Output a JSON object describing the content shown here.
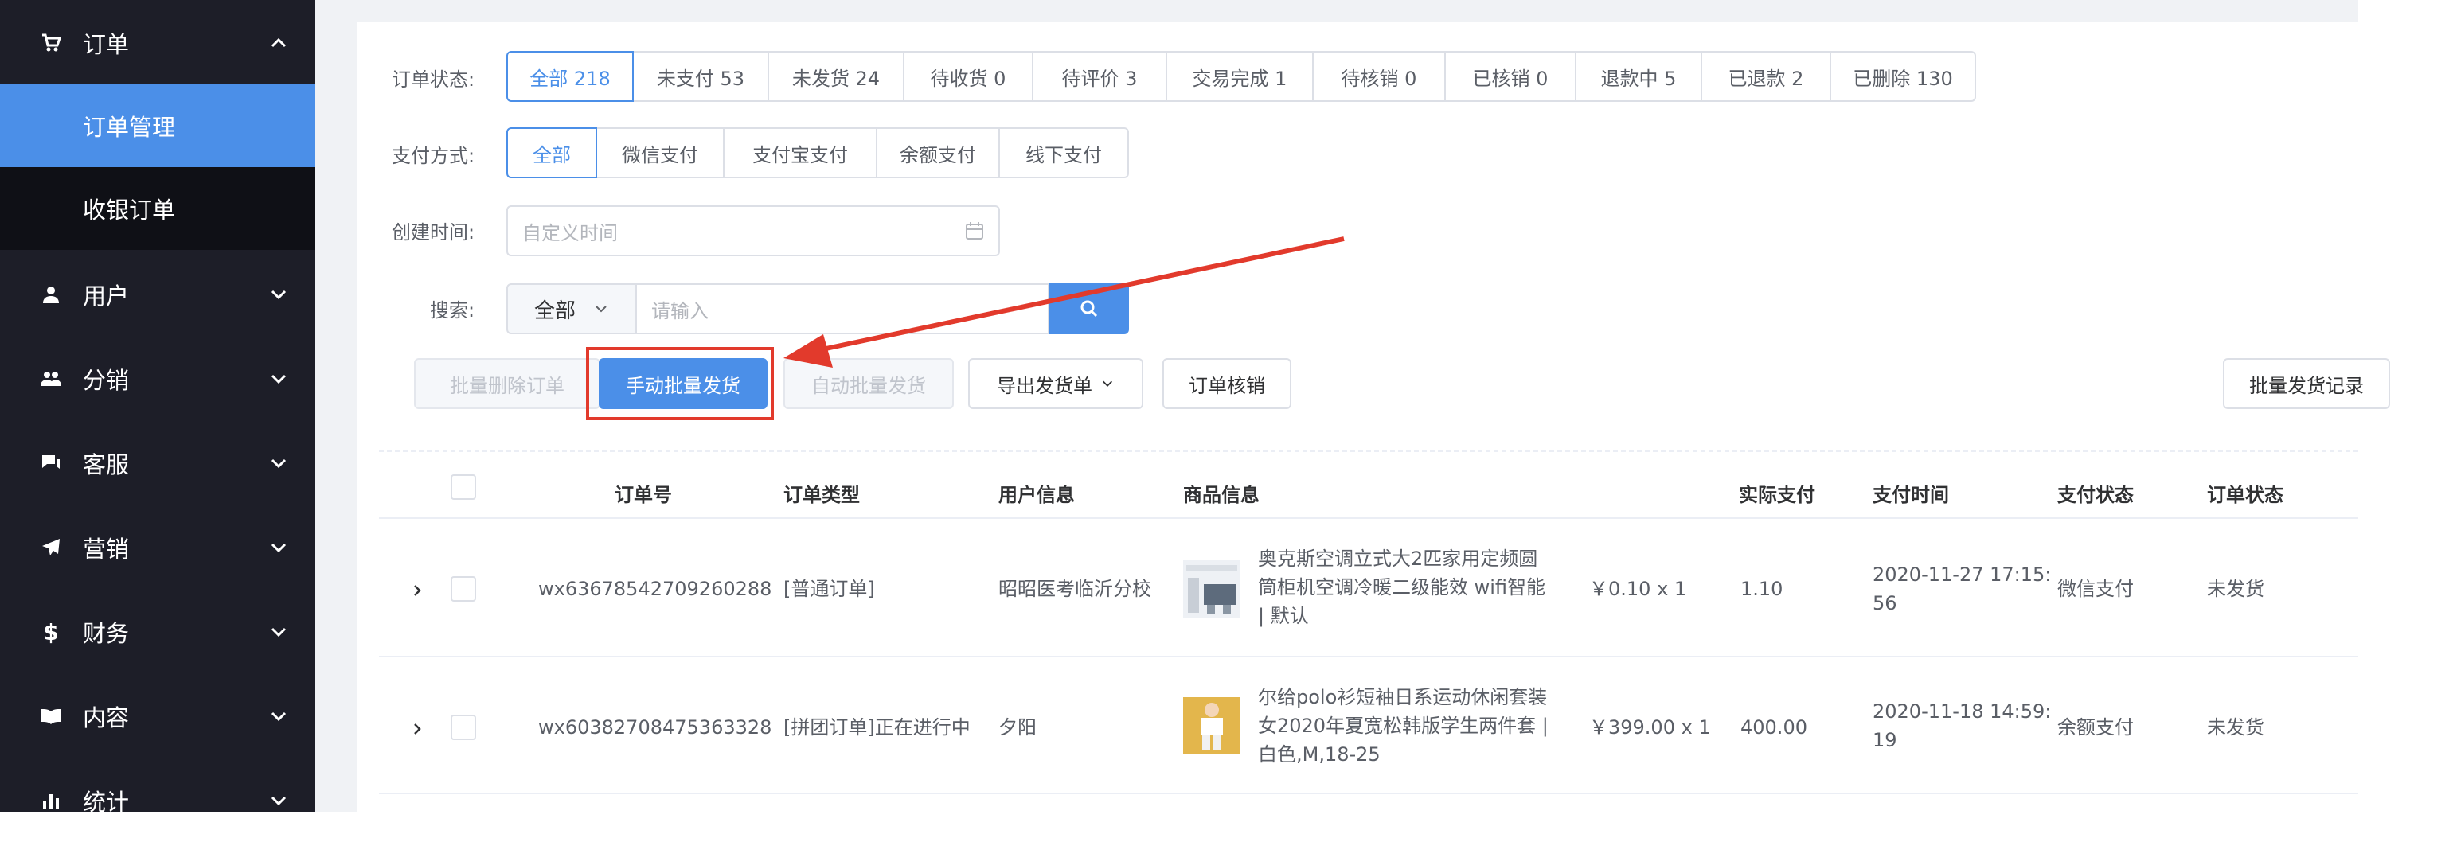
{
  "sidebar": {
    "menu": [
      {
        "label": "订单",
        "icon": "cart-icon",
        "expanded": true
      },
      {
        "label": "用户",
        "icon": "user-icon"
      },
      {
        "label": "分销",
        "icon": "users-group-icon"
      },
      {
        "label": "客服",
        "icon": "chat-icon"
      },
      {
        "label": "营销",
        "icon": "paper-plane-icon"
      },
      {
        "label": "财务",
        "icon": "dollar-icon"
      },
      {
        "label": "内容",
        "icon": "book-icon"
      },
      {
        "label": "统计",
        "icon": "bar-chart-icon"
      }
    ],
    "submenu": [
      {
        "label": "订单管理",
        "active": true
      },
      {
        "label": "收银订单",
        "active": false
      }
    ]
  },
  "filters": {
    "order_status_label": "订单状态:",
    "order_status": [
      "全部 218",
      "未支付 53",
      "未发货 24",
      "待收货 0",
      "待评价 3",
      "交易完成 1",
      "待核销 0",
      "已核销 0",
      "退款中 5",
      "已退款 2",
      "已删除 130"
    ],
    "pay_method_label": "支付方式:",
    "pay_method": [
      "全部",
      "微信支付",
      "支付宝支付",
      "余额支付",
      "线下支付"
    ],
    "created_time_label": "创建时间:",
    "created_time_placeholder": "自定义时间",
    "search_label": "搜索:",
    "search_scope": "全部",
    "search_placeholder": "请输入"
  },
  "actions": {
    "batch_delete": "批量删除订单",
    "manual_batch_ship": "手动批量发货",
    "auto_batch_ship": "自动批量发货",
    "export_ship": "导出发货单",
    "order_verify": "订单核销",
    "batch_ship_records": "批量发货记录"
  },
  "table": {
    "headers": [
      "订单号",
      "订单类型",
      "用户信息",
      "商品信息",
      "实际支付",
      "支付时间",
      "支付状态",
      "订单状态"
    ],
    "rows": [
      {
        "order_no": "wx63678542709260288",
        "type": "[普通订单]",
        "user": "昭昭医考临沂分校",
        "product_lines": [
          "奥克斯空调立式大2匹家用定频圆",
          "筒柜机空调冷暖二级能效 wifi智能",
          "| 默认"
        ],
        "price_qty": "￥0.10 x 1",
        "paid": "1.10",
        "pay_time_lines": [
          "2020-11-27 17:15:",
          "56"
        ],
        "pay_status": "微信支付",
        "order_status": "未发货"
      },
      {
        "order_no": "wx60382708475363328",
        "type": "[拼团订单]正在进行中",
        "user": "夕阳",
        "product_lines": [
          "尔给polo衫短袖日系运动休闲套装",
          "女2020年夏宽松韩版学生两件套 |",
          "白色,M,18-25"
        ],
        "price_qty": "￥399.00 x 1",
        "paid": "400.00",
        "pay_time_lines": [
          "2020-11-18 14:59:",
          "19"
        ],
        "pay_status": "余额支付",
        "order_status": "未发货"
      }
    ]
  },
  "colors": {
    "sidebar_bg": "#1d1e28",
    "submenu_bg": "#0f1016",
    "accent": "#4b8fe8",
    "annotation_red": "#e23a2c"
  }
}
